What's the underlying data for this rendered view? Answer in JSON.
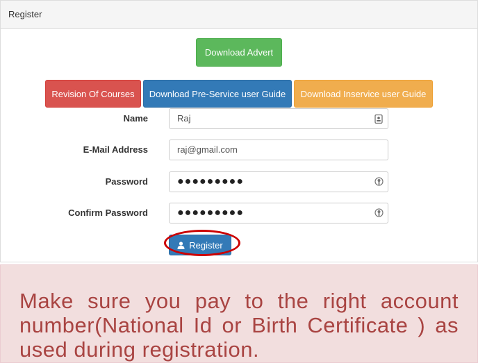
{
  "panel": {
    "heading": "Register"
  },
  "buttons": {
    "download_advert": "Download Advert",
    "revision": "Revision Of Courses",
    "pre_service": "Download Pre-Service user Guide",
    "inservice": "Download Inservice user Guide"
  },
  "form": {
    "name_label": "Name",
    "name_value": "Raj",
    "email_label": "E-Mail Address",
    "email_value": "raj@gmail.com",
    "password_label": "Password",
    "password_value": "●●●●●●●●●",
    "confirm_label": "Confirm Password",
    "confirm_value": "●●●●●●●●●",
    "register_label": "Register"
  },
  "notice": {
    "text": "Make sure you pay to the right account number(National Id or Birth Certificate ) as used during registration."
  },
  "colors": {
    "success": "#5cb85c",
    "danger": "#d9534f",
    "primary": "#337ab7",
    "warning": "#f0ad4e",
    "notice_bg": "#f2dede",
    "notice_text": "#a94442",
    "annotation": "#cc0000"
  },
  "icons": {
    "name_field": "contact-card-icon",
    "password_field": "key-icon",
    "register": "user-icon"
  }
}
